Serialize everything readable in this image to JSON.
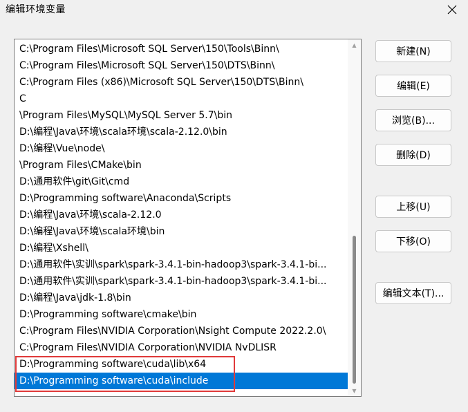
{
  "window": {
    "title": "编辑环境变量"
  },
  "path_list": {
    "items": [
      "C:\\Program Files\\Microsoft SQL Server\\150\\Tools\\Binn\\",
      "C:\\Program Files\\Microsoft SQL Server\\150\\DTS\\Binn\\",
      "C:\\Program Files (x86)\\Microsoft SQL Server\\150\\DTS\\Binn\\",
      "C",
      "\\Program Files\\MySQL\\MySQL Server 5.7\\bin",
      "D:\\编程\\Java\\环境\\scala环境\\scala-2.12.0\\bin",
      "D:\\编程\\Vue\\node\\",
      "\\Program Files\\CMake\\bin",
      "D:\\通用软件\\git\\Git\\cmd",
      "D:\\Programming software\\Anaconda\\Scripts",
      "D:\\编程\\Java\\环境\\scala-2.12.0",
      "D:\\编程\\Java\\环境\\scala环境\\bin",
      "D:\\编程\\Xshell\\",
      "D:\\通用软件\\实训\\spark\\spark-3.4.1-bin-hadoop3\\spark-3.4.1-bi...",
      "D:\\通用软件\\实训\\spark\\spark-3.4.1-bin-hadoop3\\spark-3.4.1-bi...",
      "D:\\编程\\Java\\jdk-1.8\\bin",
      "D:\\Programming software\\cmake\\bin",
      "C:\\Program Files\\NVIDIA Corporation\\Nsight Compute 2022.2.0\\",
      "C:\\Program Files\\NVIDIA Corporation\\NVIDIA NvDLISR",
      "D:\\Programming software\\cuda\\lib\\x64",
      "D:\\Programming software\\cuda\\include"
    ],
    "selected_index": 20
  },
  "buttons": {
    "new": "新建(N)",
    "edit": "编辑(E)",
    "browse": "浏览(B)...",
    "delete": "删除(D)",
    "move_up": "上移(U)",
    "move_down": "下移(O)",
    "edit_text": "编辑文本(T)..."
  },
  "colors": {
    "selection": "#0078d7",
    "highlight_border": "#e03a3a"
  }
}
